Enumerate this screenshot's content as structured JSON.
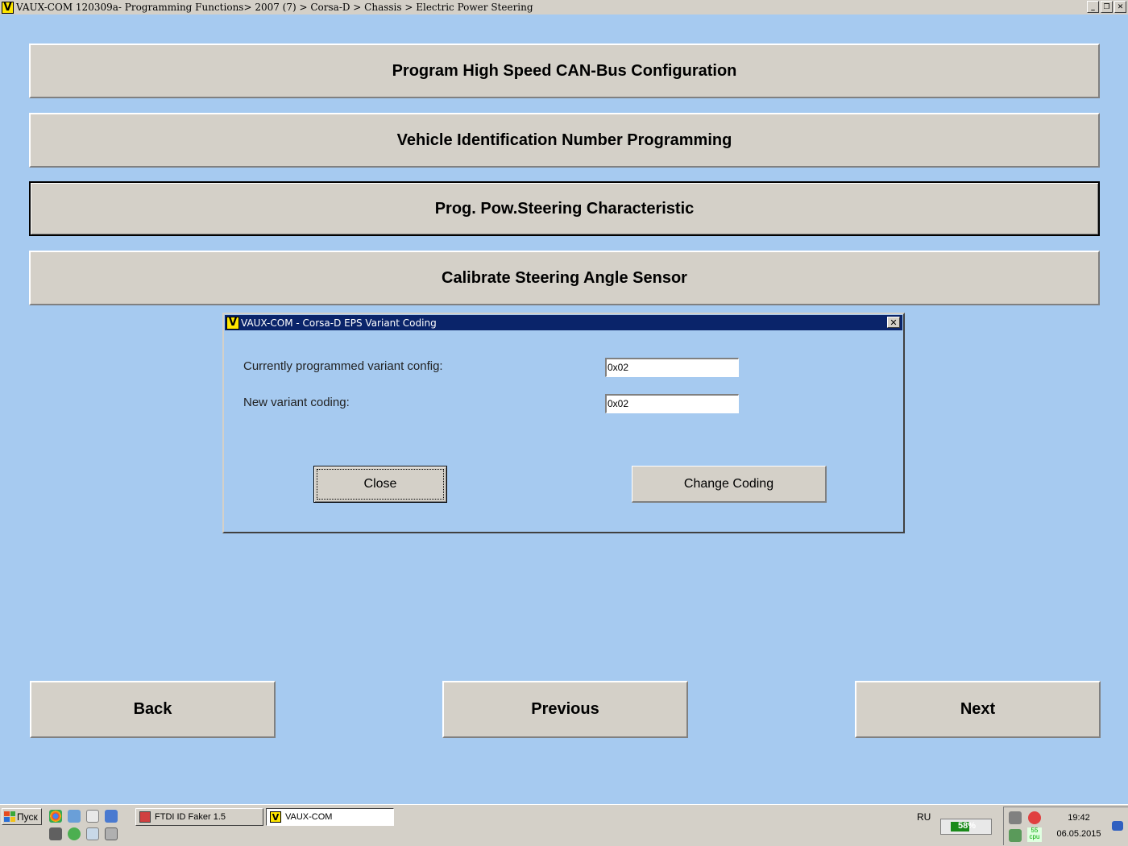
{
  "window": {
    "title": "VAUX-COM 120309a- Programming Functions> 2007 (7) > Corsa-D > Chassis > Electric Power Steering",
    "logo": "V",
    "controls": {
      "minimize": "_",
      "restore": "❐",
      "close": "✕"
    }
  },
  "functions": [
    {
      "label": "Program High Speed CAN-Bus Configuration"
    },
    {
      "label": "Vehicle Identification Number Programming"
    },
    {
      "label": "Prog. Pow.Steering Characteristic"
    },
    {
      "label": "Calibrate Steering Angle Sensor"
    }
  ],
  "dialog": {
    "title": "VAUX-COM - Corsa-D EPS Variant Coding",
    "close_glyph": "✕",
    "current_label": "Currently programmed variant config:",
    "current_value": "0x02",
    "new_label": "New variant coding:",
    "new_value": "0x02",
    "close_button": "Close",
    "change_button": "Change Coding"
  },
  "nav": {
    "back": "Back",
    "previous": "Previous",
    "next": "Next"
  },
  "taskbar": {
    "start": "Пуск",
    "items": [
      {
        "label": "FTDI ID Faker 1.5"
      },
      {
        "label": "VAUX-COM"
      }
    ],
    "language": "RU",
    "battery_label": "58%",
    "battery_level": 0.58,
    "cpu_label_top": "55",
    "cpu_label_bottom": "cpu",
    "time": "19:42",
    "date": "06.05.2015"
  },
  "colors": {
    "background": "#a6caf0",
    "button_face": "#d4d0c8",
    "dialog_title": "#0a246a",
    "logo_yellow": "#ffe600"
  }
}
